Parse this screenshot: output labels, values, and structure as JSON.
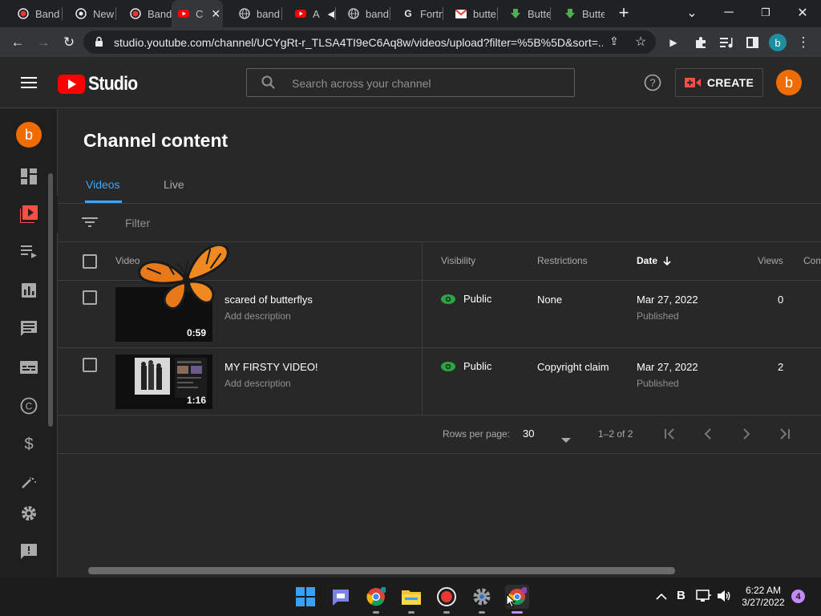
{
  "browser": {
    "tabs": [
      {
        "label": "Band",
        "favicon": "record-icon"
      },
      {
        "label": "New",
        "favicon": "chrome-icon"
      },
      {
        "label": "Band",
        "favicon": "record-icon"
      },
      {
        "label": "C",
        "favicon": "youtube-icon",
        "active": true
      },
      {
        "label": "band",
        "favicon": "globe-icon"
      },
      {
        "label": "A",
        "favicon": "youtube-icon"
      },
      {
        "label": "band",
        "favicon": "globe-icon"
      },
      {
        "label": "Fortn",
        "favicon": "g-icon"
      },
      {
        "label": "butte",
        "favicon": "gmail-icon"
      },
      {
        "label": "Butte",
        "favicon": "download-icon"
      },
      {
        "label": "Butte",
        "favicon": "download-icon"
      }
    ],
    "new_tab": "+",
    "url": "studio.youtube.com/channel/UCYgRt-r_TLSA4TI9eC6Aq8w/videos/upload?filter=%5B%5D&sort=...",
    "profile_initial": "b"
  },
  "header": {
    "logo_text": "Studio",
    "search_placeholder": "Search across your channel",
    "create_label": "CREATE",
    "avatar_initial": "b"
  },
  "sidebar": {
    "avatar_initial": "b",
    "items": [
      "dashboard-icon",
      "content-icon",
      "playlists-icon",
      "analytics-icon",
      "comments-icon",
      "subtitles-icon",
      "copyright-icon",
      "monetization-icon",
      "customization-icon",
      "settings-icon",
      "feedback-icon"
    ]
  },
  "main": {
    "title": "Channel content",
    "tabs": [
      {
        "label": "Videos",
        "active": true
      },
      {
        "label": "Live",
        "active": false
      }
    ],
    "filter_placeholder": "Filter",
    "columns": {
      "video": "Video",
      "visibility": "Visibility",
      "restrictions": "Restrictions",
      "date": "Date",
      "views": "Views",
      "comments": "Com"
    },
    "rows": [
      {
        "title": "scared of butterflys",
        "description": "Add description",
        "duration": "0:59",
        "visibility": "Public",
        "restrictions": "None",
        "date": "Mar 27, 2022",
        "date_status": "Published",
        "views": "0"
      },
      {
        "title": "MY FIRSTY VIDEO!",
        "description": "Add description",
        "duration": "1:16",
        "visibility": "Public",
        "restrictions": "Copyright claim",
        "date": "Mar 27, 2022",
        "date_status": "Published",
        "views": "2"
      }
    ],
    "pagination": {
      "rows_per_page_label": "Rows per page:",
      "rows_per_page": "30",
      "range": "1–2 of 2"
    }
  },
  "taskbar": {
    "time": "6:22 AM",
    "date": "3/27/2022",
    "notification_count": "4",
    "tray_letter": "B"
  },
  "colors": {
    "accent_blue": "#3ea6ff",
    "youtube_red": "#ff0000",
    "public_green": "#2ba640",
    "avatar_orange": "#ef6c00"
  }
}
